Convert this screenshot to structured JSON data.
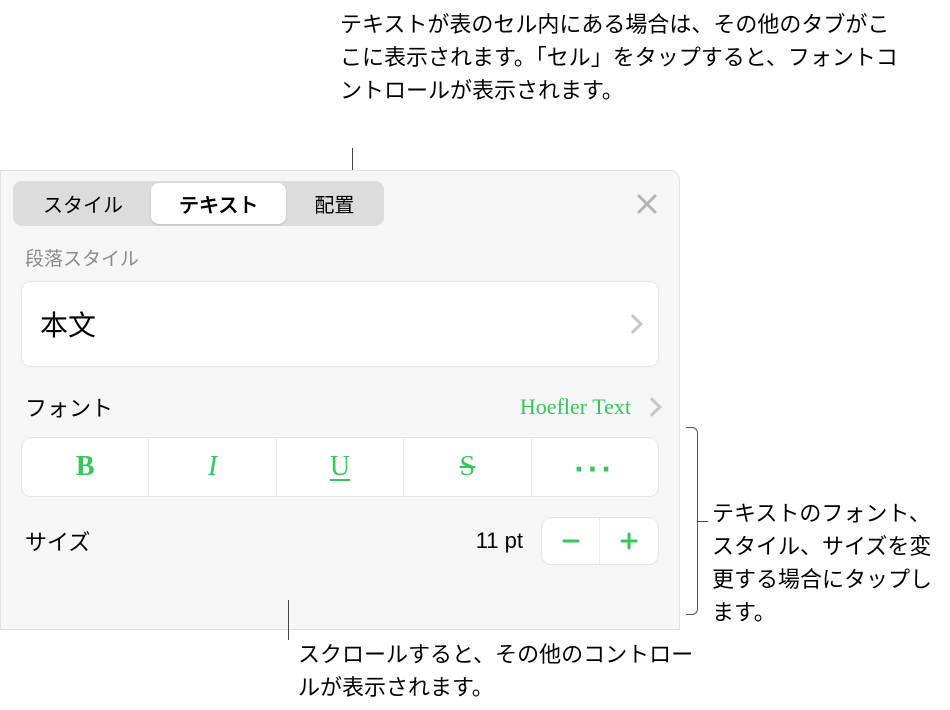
{
  "annotations": {
    "top": "テキストが表のセル内にある場合は、その他のタブがここに表示されます。「セル」をタップすると、フォントコントロールが表示されます。",
    "right": "テキストのフォント、スタイル、サイズを変更する場合にタップします。",
    "bottom": "スクロールすると、その他のコントロールが表示されます。"
  },
  "tabs": {
    "style": "スタイル",
    "text": "テキスト",
    "arrange": "配置"
  },
  "section": {
    "paragraphStyle": "段落スタイル"
  },
  "paragraphStyleValue": "本文",
  "font": {
    "label": "フォント",
    "value": "Hoefler Text"
  },
  "styleButtons": {
    "bold": "B",
    "italic": "I",
    "underline": "U",
    "strike": "S"
  },
  "size": {
    "label": "サイズ",
    "value": "11 pt"
  }
}
